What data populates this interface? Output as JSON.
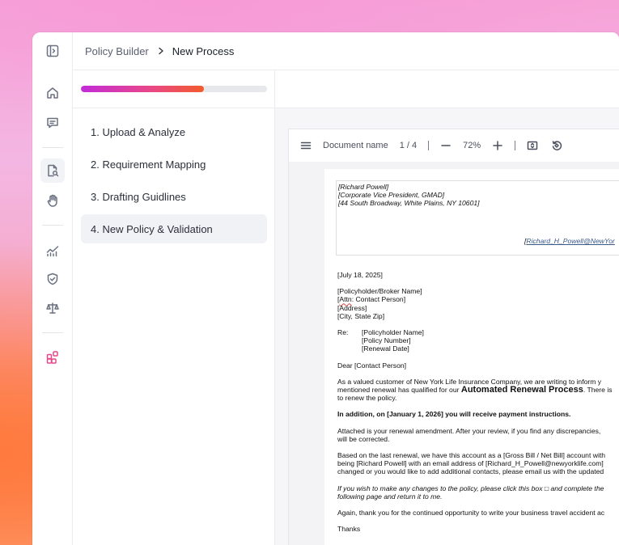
{
  "breadcrumb": {
    "parent": "Policy Builder",
    "current": "New Process"
  },
  "progress": {
    "percent": 66
  },
  "steps": [
    {
      "label": "1. Upload & Analyze"
    },
    {
      "label": "2. Requirement Mapping"
    },
    {
      "label": "3. Drafting Guidlines"
    },
    {
      "label": "4. New Policy & Validation"
    }
  ],
  "viewer": {
    "document_name": "Document name",
    "page_indicator": "1 / 4",
    "zoom": "72%"
  },
  "letter": {
    "letterhead": [
      "[Richard Powell]",
      "[Corporate Vice President, GMAD]",
      "[44 South Broadway, White Plains, NY 10601]"
    ],
    "letterhead_email_open": "[",
    "letterhead_email": "Richard_H_Powell@NewYor",
    "date": "[July 18, 2025]",
    "address": {
      "line1": "[Policyholder/Broker Name]",
      "attn_open": "[",
      "attn_word": "Attn",
      "attn_rest": ": Contact Person]",
      "line3": "[Address]",
      "line4": "[City, State  Zip]"
    },
    "re_label": "Re:",
    "re_lines": [
      "[Policyholder Name]",
      "[Policy Number]",
      "[Renewal Date]"
    ],
    "salutation": "Dear [Contact Person]",
    "para1_line1": "As a valued customer of New York Life Insurance Company, we are writing to inform y",
    "para1_line2_pre": "mentioned renewal has qualified for our ",
    "para1_line2_bold": "Automated Renewal Process",
    "para1_line2_post": ".  There is",
    "para1_line3": "to renew the policy.",
    "para2": "In addition, on [January 1, 2026] you will receive payment instructions.",
    "para3_line1": "Attached is your renewal amendment.  After your review, if you find any discrepancies,",
    "para3_line2": "will be corrected.",
    "para4_line1": "Based on the last renewal, we have this account as a [Gross Bill / Net Bill] account with",
    "para4_line2": "being [Richard Powell] with an email address of [Richard_H_Powell@newyorklife.com]",
    "para4_line3": "changed or you would like to add additional contacts, please email us with the updated",
    "para5_line1": "If you wish to make any changes to the policy, please click this box □  and complete the",
    "para5_line2": "following page and return it to me.",
    "para6": "Again, thank you for the continued opportunity to write your business travel accident ac",
    "closing": "Thanks"
  },
  "colors": {
    "progress_start": "#c22bd8",
    "progress_end": "#f35b2c",
    "accent_pink": "#e8478a",
    "text_primary": "#1b1f2a"
  }
}
